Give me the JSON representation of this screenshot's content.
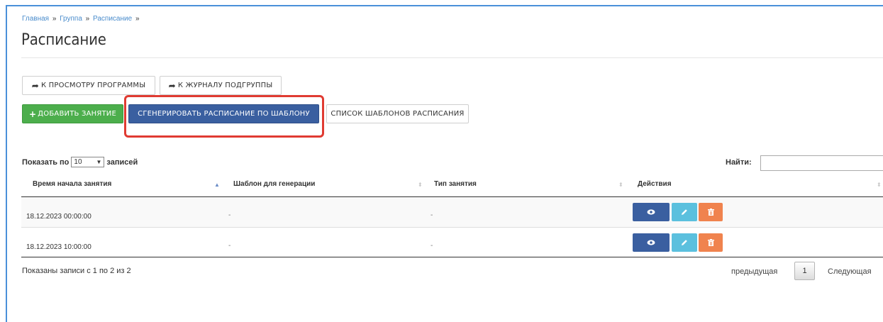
{
  "breadcrumb": [
    "Главная",
    "Группа",
    "Расписание"
  ],
  "breadcrumb_sep": "»",
  "page_title": "Расписание",
  "nav_buttons": {
    "view_program": "К ПРОСМОТРУ ПРОГРАММЫ",
    "subgroup_journal": "К ЖУРНАЛУ ПОДГРУППЫ"
  },
  "actions": {
    "add_lesson": "ДОБАВИТЬ ЗАНЯТИЕ",
    "generate_schedule": "СГЕНЕРИРОВАТЬ РАСПИСАНИЕ ПО ШАБЛОНУ",
    "template_list": "СПИСОК ШАБЛОНОВ РАСПИСАНИЯ"
  },
  "table_controls": {
    "show_prefix": "Показать по",
    "page_size": "10",
    "show_suffix": "записей",
    "search_label": "Найти:",
    "search_value": ""
  },
  "columns": [
    "Время начала занятия",
    "Шаблон для генерации",
    "Тип занятия",
    "Действия"
  ],
  "rows": [
    {
      "start_time": "18.12.2023 00:00:00",
      "template": "-",
      "lesson_type": "-"
    },
    {
      "start_time": "18.12.2023 10:00:00",
      "template": "-",
      "lesson_type": "-"
    }
  ],
  "footer": {
    "info": "Показаны записи с 1 по 2 из 2",
    "prev": "предыдущая",
    "current_page": "1",
    "next": "Следующая"
  },
  "colors": {
    "primary": "#3a5fa0",
    "success": "#4cae4c",
    "info": "#5bc0de",
    "danger": "#f0834e",
    "highlight": "#e03b32",
    "frame": "#4a90d9"
  },
  "icons": {
    "arrow": "share-arrow-icon",
    "plus": "plus-icon",
    "view": "eye-icon",
    "edit": "pencil-icon",
    "delete": "trash-icon"
  }
}
